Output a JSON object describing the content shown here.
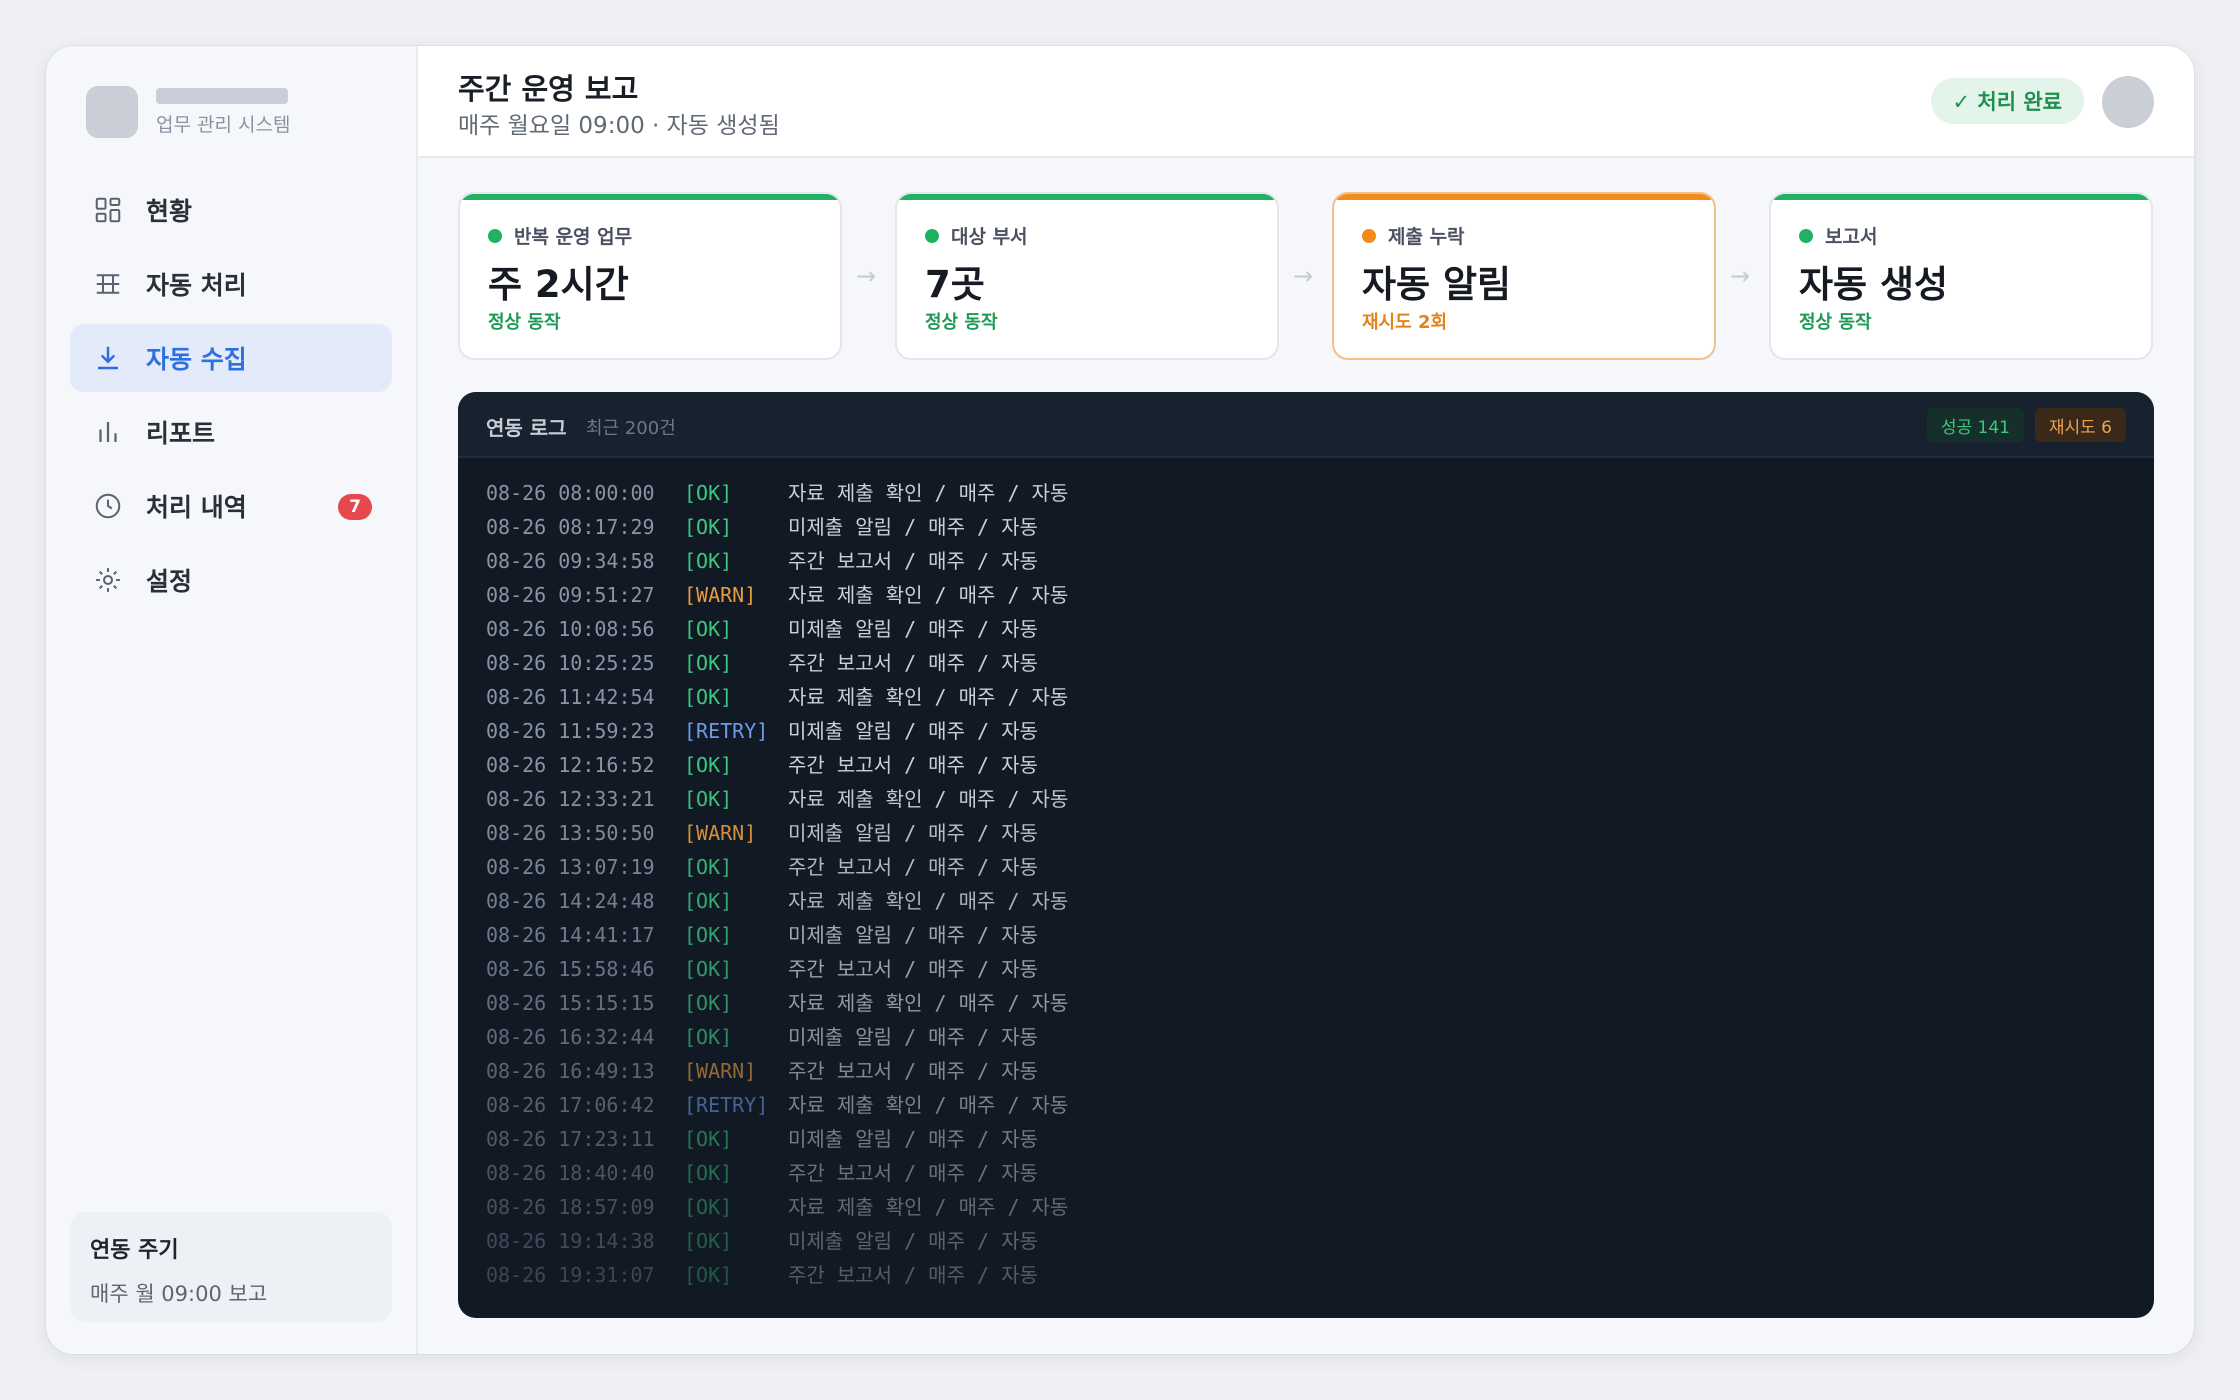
{
  "sidebar": {
    "brand_sub": "업무 관리 시스템",
    "items": [
      {
        "label": "현황",
        "icon": "grid-icon",
        "active": false
      },
      {
        "label": "자동 처리",
        "icon": "table-icon",
        "active": false
      },
      {
        "label": "자동 수집",
        "icon": "download-icon",
        "active": true
      },
      {
        "label": "리포트",
        "icon": "bar-chart-icon",
        "active": false
      },
      {
        "label": "처리 내역",
        "icon": "clock-icon",
        "active": false,
        "badge": "7"
      },
      {
        "label": "설정",
        "icon": "gear-icon",
        "active": false
      }
    ],
    "cycle": {
      "title": "연동 주기",
      "value": "매주 월 09:00 보고"
    }
  },
  "header": {
    "title": "주간 운영 보고",
    "subtitle": "매주 월요일 09:00 · 자동 생성됨",
    "status": "✓ 처리 완료"
  },
  "steps": [
    {
      "label": "반복 운영 업무",
      "value": "주 2시간",
      "status": "정상 동작",
      "state": "ok"
    },
    {
      "label": "대상 부서",
      "value": "7곳",
      "status": "정상 동작",
      "state": "ok"
    },
    {
      "label": "제출 누락",
      "value": "자동 알림",
      "status": "재시도 2회",
      "state": "warn"
    },
    {
      "label": "보고서",
      "value": "자동 생성",
      "status": "정상 동작",
      "state": "ok"
    }
  ],
  "arrow": "→",
  "log": {
    "title": "연동 로그",
    "subtitle": "최근 200건",
    "success_tag": "성공 141",
    "retry_tag": "재시도 6",
    "lines": [
      {
        "time": "08-26 08:00:00",
        "level": "OK",
        "msg": "자료 제출 확인 / 매주 / 자동"
      },
      {
        "time": "08-26 08:17:29",
        "level": "OK",
        "msg": "미제출 알림 / 매주 / 자동"
      },
      {
        "time": "08-26 09:34:58",
        "level": "OK",
        "msg": "주간 보고서 / 매주 / 자동"
      },
      {
        "time": "08-26 09:51:27",
        "level": "WARN",
        "msg": "자료 제출 확인 / 매주 / 자동"
      },
      {
        "time": "08-26 10:08:56",
        "level": "OK",
        "msg": "미제출 알림 / 매주 / 자동"
      },
      {
        "time": "08-26 10:25:25",
        "level": "OK",
        "msg": "주간 보고서 / 매주 / 자동"
      },
      {
        "time": "08-26 11:42:54",
        "level": "OK",
        "msg": "자료 제출 확인 / 매주 / 자동"
      },
      {
        "time": "08-26 11:59:23",
        "level": "RETRY",
        "msg": "미제출 알림 / 매주 / 자동"
      },
      {
        "time": "08-26 12:16:52",
        "level": "OK",
        "msg": "주간 보고서 / 매주 / 자동"
      },
      {
        "time": "08-26 12:33:21",
        "level": "OK",
        "msg": "자료 제출 확인 / 매주 / 자동"
      },
      {
        "time": "08-26 13:50:50",
        "level": "WARN",
        "msg": "미제출 알림 / 매주 / 자동"
      },
      {
        "time": "08-26 13:07:19",
        "level": "OK",
        "msg": "주간 보고서 / 매주 / 자동"
      },
      {
        "time": "08-26 14:24:48",
        "level": "OK",
        "msg": "자료 제출 확인 / 매주 / 자동"
      },
      {
        "time": "08-26 14:41:17",
        "level": "OK",
        "msg": "미제출 알림 / 매주 / 자동"
      },
      {
        "time": "08-26 15:58:46",
        "level": "OK",
        "msg": "주간 보고서 / 매주 / 자동"
      },
      {
        "time": "08-26 15:15:15",
        "level": "OK",
        "msg": "자료 제출 확인 / 매주 / 자동"
      },
      {
        "time": "08-26 16:32:44",
        "level": "OK",
        "msg": "미제출 알림 / 매주 / 자동"
      },
      {
        "time": "08-26 16:49:13",
        "level": "WARN",
        "msg": "주간 보고서 / 매주 / 자동"
      },
      {
        "time": "08-26 17:06:42",
        "level": "RETRY",
        "msg": "자료 제출 확인 / 매주 / 자동"
      },
      {
        "time": "08-26 17:23:11",
        "level": "OK",
        "msg": "미제출 알림 / 매주 / 자동"
      },
      {
        "time": "08-26 18:40:40",
        "level": "OK",
        "msg": "주간 보고서 / 매주 / 자동"
      },
      {
        "time": "08-26 18:57:09",
        "level": "OK",
        "msg": "자료 제출 확인 / 매주 / 자동"
      },
      {
        "time": "08-26 19:14:38",
        "level": "OK",
        "msg": "미제출 알림 / 매주 / 자동"
      },
      {
        "time": "08-26 19:31:07",
        "level": "OK",
        "msg": "주간 보고서 / 매주 / 자동"
      }
    ]
  },
  "colors": {
    "accent": "#2f6fe0",
    "ok": "#20b262",
    "warn": "#f08b1c",
    "badge": "#e5484d",
    "log_bg": "#111925"
  }
}
